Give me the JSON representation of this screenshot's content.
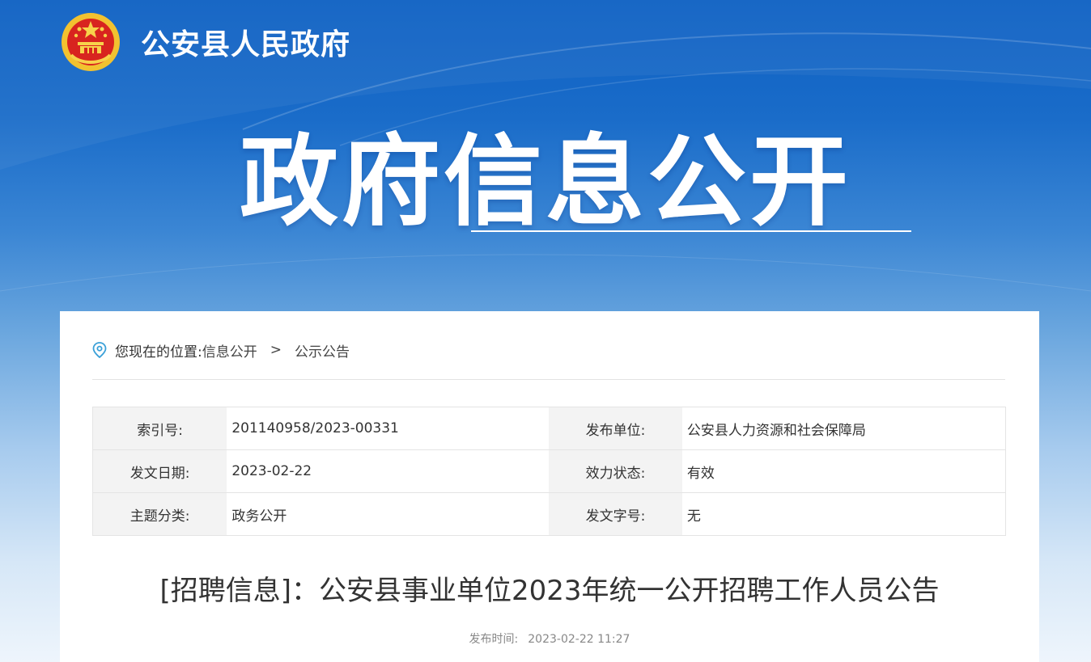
{
  "header": {
    "site_title": "公安县人民政府",
    "emblem_icon": "national-emblem-icon"
  },
  "hero": {
    "title": "政府信息公开"
  },
  "breadcrumb": {
    "prefix": "您现在的位置:",
    "items": [
      "信息公开",
      "公示公告"
    ],
    "separator": ">"
  },
  "meta": {
    "rows": [
      {
        "label_left": "索引号:",
        "value_left": "201140958/2023-00331",
        "label_right": "发布单位:",
        "value_right": "公安县人力资源和社会保障局"
      },
      {
        "label_left": "发文日期:",
        "value_left": "2023-02-22",
        "label_right": "效力状态:",
        "value_right": "有效"
      },
      {
        "label_left": "主题分类:",
        "value_left": "政务公开",
        "label_right": "发文字号:",
        "value_right": "无"
      }
    ]
  },
  "article": {
    "title": "[招聘信息]：公安县事业单位2023年统一公开招聘工作人员公告",
    "publish_label": "发布时间:",
    "publish_time": "2023-02-22 11:27"
  },
  "colors": {
    "header_blue": "#0c5fc2",
    "panel_bg": "#ffffff",
    "label_bg": "#f3f3f3",
    "accent_icon": "#3aa0d8"
  }
}
